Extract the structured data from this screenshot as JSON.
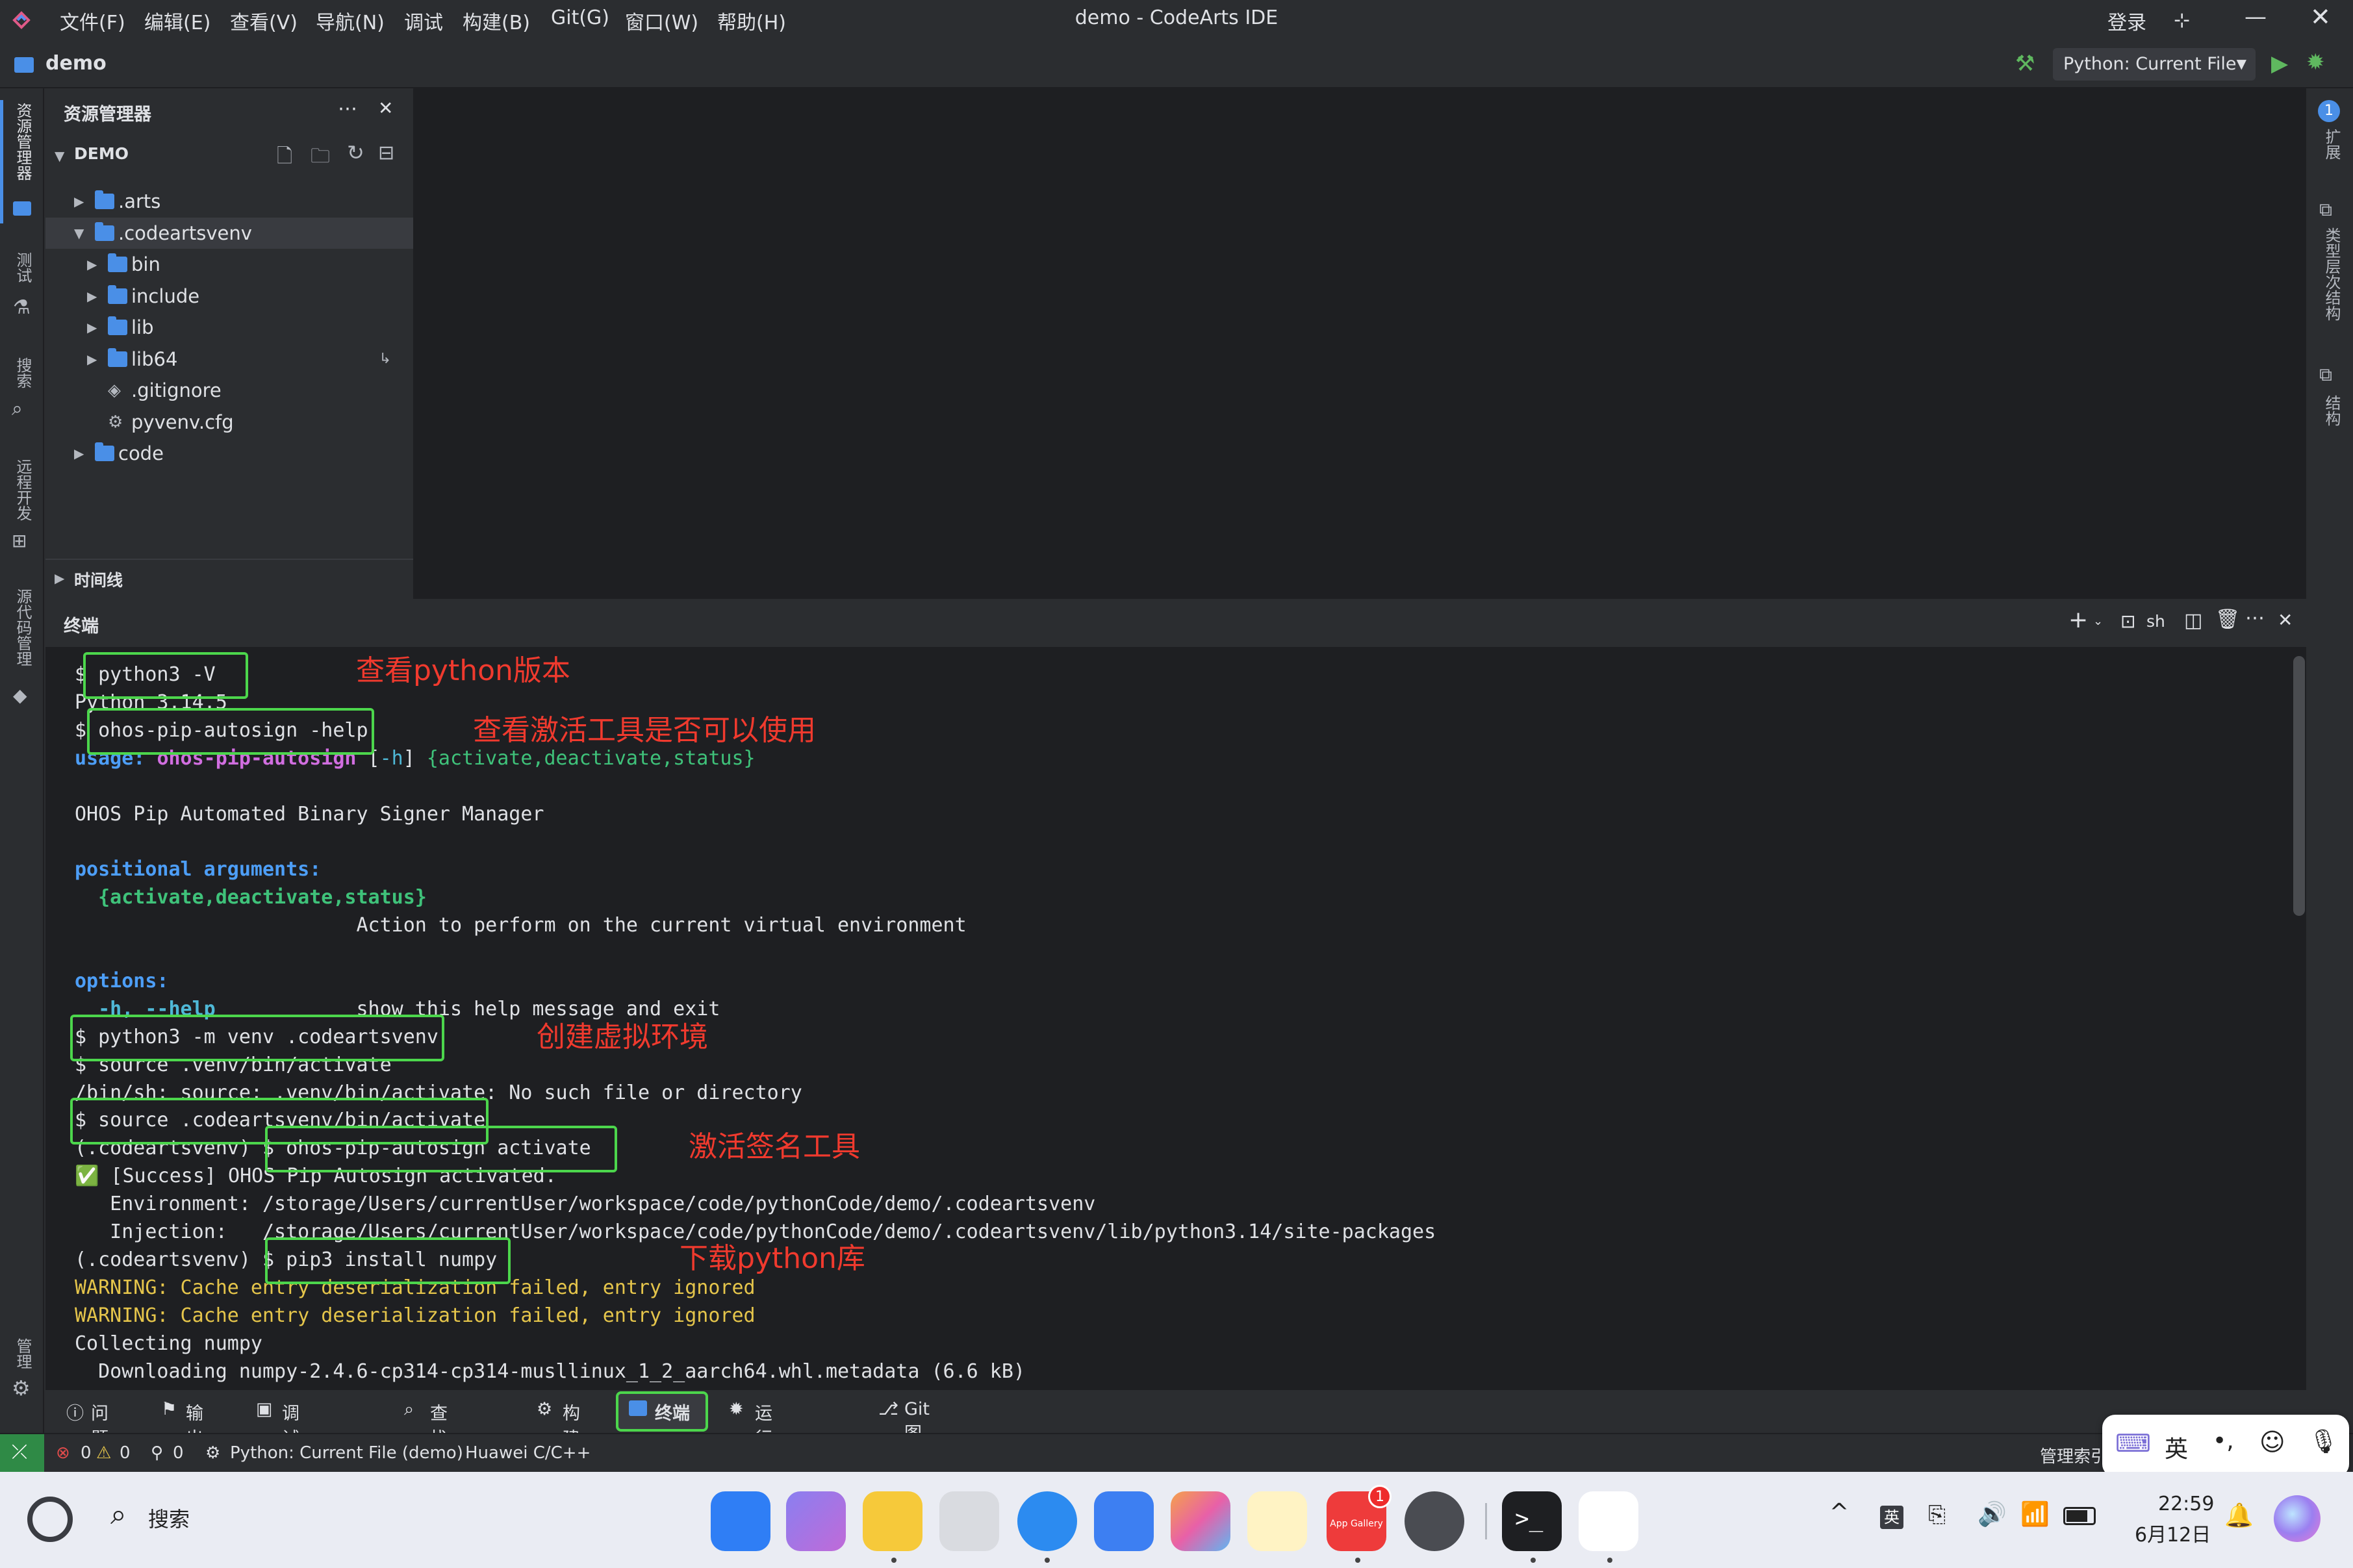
{
  "window": {
    "title": "demo - CodeArts IDE",
    "menu": [
      "文件(F)",
      "编辑(E)",
      "查看(V)",
      "导航(N)",
      "调试",
      "构建(B)",
      "Git(G)",
      "窗口(W)",
      "帮助(H)"
    ],
    "login": "登录"
  },
  "project": {
    "name": "demo",
    "run_config": "Python: Current File"
  },
  "left_activity": [
    "资源管理器",
    "测试",
    "搜索",
    "远程开发",
    "源代码管理",
    "管理"
  ],
  "right_activity": [
    "扩展",
    "类型层次结构",
    "结构"
  ],
  "right_badge": "1",
  "explorer": {
    "title": "资源管理器",
    "section": "DEMO",
    "items": [
      {
        "label": ".arts",
        "indent": 1,
        "kind": "folder",
        "expanded": false
      },
      {
        "label": ".codeartsvenv",
        "indent": 1,
        "kind": "folder",
        "expanded": true,
        "selected": true
      },
      {
        "label": "bin",
        "indent": 2,
        "kind": "folder",
        "expanded": false
      },
      {
        "label": "include",
        "indent": 2,
        "kind": "folder",
        "expanded": false
      },
      {
        "label": "lib",
        "indent": 2,
        "kind": "folder",
        "expanded": false
      },
      {
        "label": "lib64",
        "indent": 2,
        "kind": "folder",
        "expanded": false,
        "link": true
      },
      {
        "label": ".gitignore",
        "indent": 2,
        "kind": "file"
      },
      {
        "label": "pyvenv.cfg",
        "indent": 2,
        "kind": "gear-file"
      },
      {
        "label": "code",
        "indent": 1,
        "kind": "folder",
        "expanded": false
      }
    ],
    "timeline": "时间线"
  },
  "terminal": {
    "title": "终端",
    "shell": "sh",
    "lines": [
      {
        "text": "$ python3 -V",
        "color": "#dfe1e5"
      },
      {
        "text": "Python 3.14.5",
        "color": "#dfe1e5"
      },
      {
        "text": "$ ohos-pip-autosign -help",
        "color": "#dfe1e5"
      },
      {
        "segments": [
          {
            "text": "usage: ",
            "color": "#4d9ef7",
            "bold": true
          },
          {
            "text": "ohos-pip-autosign",
            "color": "#d16ee0",
            "bold": true
          },
          {
            "text": " [",
            "color": "#dfe1e5"
          },
          {
            "text": "-h",
            "color": "#4fb8d6"
          },
          {
            "text": "] ",
            "color": "#dfe1e5"
          },
          {
            "text": "{activate,deactivate,status}",
            "color": "#3fc27a"
          }
        ]
      },
      {
        "text": "",
        "color": "#dfe1e5"
      },
      {
        "text": "OHOS Pip Automated Binary Signer Manager",
        "color": "#dfe1e5"
      },
      {
        "text": "",
        "color": "#dfe1e5"
      },
      {
        "text": "positional arguments:",
        "color": "#4d9ef7",
        "bold": true
      },
      {
        "text": "  {activate,deactivate,status}",
        "color": "#3fc27a",
        "bold": true
      },
      {
        "text": "                        Action to perform on the current virtual environment",
        "color": "#dfe1e5"
      },
      {
        "text": "",
        "color": "#dfe1e5"
      },
      {
        "text": "options:",
        "color": "#4d9ef7",
        "bold": true
      },
      {
        "segments": [
          {
            "text": "  -h, --help",
            "color": "#4fb8d6",
            "bold": true
          },
          {
            "text": "            show this help message and exit",
            "color": "#dfe1e5"
          }
        ]
      },
      {
        "text": "$ python3 -m venv .codeartsvenv",
        "color": "#dfe1e5"
      },
      {
        "text": "$ source .venv/bin/activate",
        "color": "#dfe1e5"
      },
      {
        "text": "/bin/sh: source: .venv/bin/activate: No such file or directory",
        "color": "#dfe1e5"
      },
      {
        "text": "$ source .codeartsvenv/bin/activate",
        "color": "#dfe1e5"
      },
      {
        "text": "(.codeartsvenv) $ ohos-pip-autosign activate",
        "color": "#dfe1e5"
      },
      {
        "text": "✅ [Success] OHOS Pip Autosign activated.",
        "color": "#dfe1e5"
      },
      {
        "text": "   Environment: /storage/Users/currentUser/workspace/code/pythonCode/demo/.codeartsvenv",
        "color": "#dfe1e5"
      },
      {
        "text": "   Injection:   /storage/Users/currentUser/workspace/code/pythonCode/demo/.codeartsvenv/lib/python3.14/site-packages",
        "color": "#dfe1e5"
      },
      {
        "text": "(.codeartsvenv) $ pip3 install numpy",
        "color": "#dfe1e5"
      },
      {
        "text": "WARNING: Cache entry deserialization failed, entry ignored",
        "color": "#e5c54b"
      },
      {
        "text": "WARNING: Cache entry deserialization failed, entry ignored",
        "color": "#e5c54b"
      },
      {
        "text": "Collecting numpy",
        "color": "#dfe1e5"
      },
      {
        "text": "  Downloading numpy-2.4.6-cp314-cp314-musllinux_1_2_aarch64.whl.metadata (6.6 kB)",
        "color": "#dfe1e5"
      }
    ],
    "annotations": [
      {
        "text": "查看python版本",
        "line": 0
      },
      {
        "text": "查看激活工具是否可以使用",
        "line": 2
      },
      {
        "text": "创建虚拟环境",
        "line": 13
      },
      {
        "text": "激活签名工具",
        "line": 17
      },
      {
        "text": "下载python库",
        "line": 21
      }
    ]
  },
  "panel_tabs": [
    "问题",
    "输出",
    "调试控制台",
    "查找用法",
    "构建",
    "终端",
    "运行和调试",
    "Git图谱"
  ],
  "status": {
    "errors": "0",
    "warnings": "0",
    "ports": "0",
    "run": "Python: Current File (demo)",
    "lang": "Huawei C/C++",
    "right": "管理索引"
  },
  "ime": {
    "mode": "英"
  },
  "taskbar": {
    "search": "搜索",
    "time": "22:59",
    "date": "6月12日",
    "appgallery_badge": "1",
    "appgallery_label": "App Gallery",
    "ime_indicator": "英"
  },
  "colors": {
    "highlight": "#4cd64c",
    "annotation": "#f03a2e",
    "accent": "#4a8fe7"
  }
}
